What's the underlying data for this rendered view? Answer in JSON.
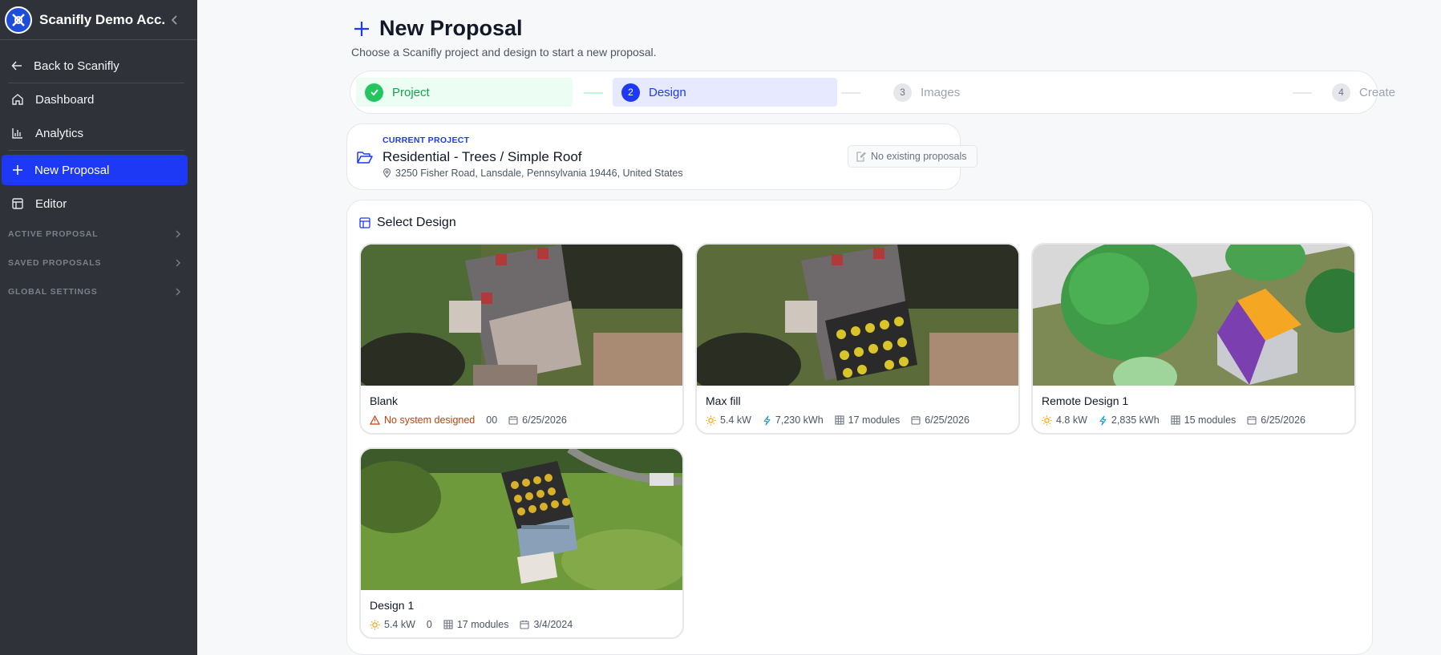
{
  "sidebar": {
    "org_name": "Scanifly Demo Acc...",
    "items": [
      {
        "label": "Back to Scanifly"
      },
      {
        "label": "Dashboard"
      },
      {
        "label": "Analytics"
      },
      {
        "label": "New Proposal"
      },
      {
        "label": "Editor"
      }
    ],
    "sections": [
      "ACTIVE PROPOSAL",
      "SAVED PROPOSALS",
      "GLOBAL SETTINGS"
    ]
  },
  "page": {
    "title": "New Proposal",
    "subtitle": "Choose a Scanifly project and design to start a new proposal."
  },
  "stepper": {
    "steps": [
      {
        "num": "",
        "label": "Project",
        "state": "complete"
      },
      {
        "num": "2",
        "label": "Design",
        "state": "active"
      },
      {
        "num": "3",
        "label": "Images",
        "state": "pending"
      },
      {
        "num": "4",
        "label": "Create",
        "state": "pending"
      }
    ]
  },
  "project": {
    "label": "CURRENT PROJECT",
    "name": "Residential - Trees / Simple Roof",
    "address": "3250 Fisher Road, Lansdale, Pennsylvania 19446, United States",
    "proposals_status": "No existing proposals"
  },
  "design_panel": {
    "title": "Select Design",
    "designs": [
      {
        "name": "Blank",
        "warning": "No system designed",
        "extra": "00",
        "date": "6/25/2026"
      },
      {
        "name": "Max fill",
        "power": "5.4 kW",
        "energy": "7,230 kWh",
        "modules": "17 modules",
        "date": "6/25/2026"
      },
      {
        "name": "Remote Design 1",
        "power": "4.8 kW",
        "energy": "2,835 kWh",
        "modules": "15 modules",
        "date": "6/25/2026"
      },
      {
        "name": "Design 1",
        "power": "5.4 kW",
        "extra": "0",
        "modules": "17 modules",
        "date": "3/4/2024"
      }
    ]
  },
  "colors": {
    "sidebar_bg": "#2f3238",
    "accent": "#1d39f5",
    "success": "#22c55e",
    "warning": "#c2410c",
    "energy_icon": "#0ea5e9",
    "sun_icon": "#f59e0b"
  }
}
